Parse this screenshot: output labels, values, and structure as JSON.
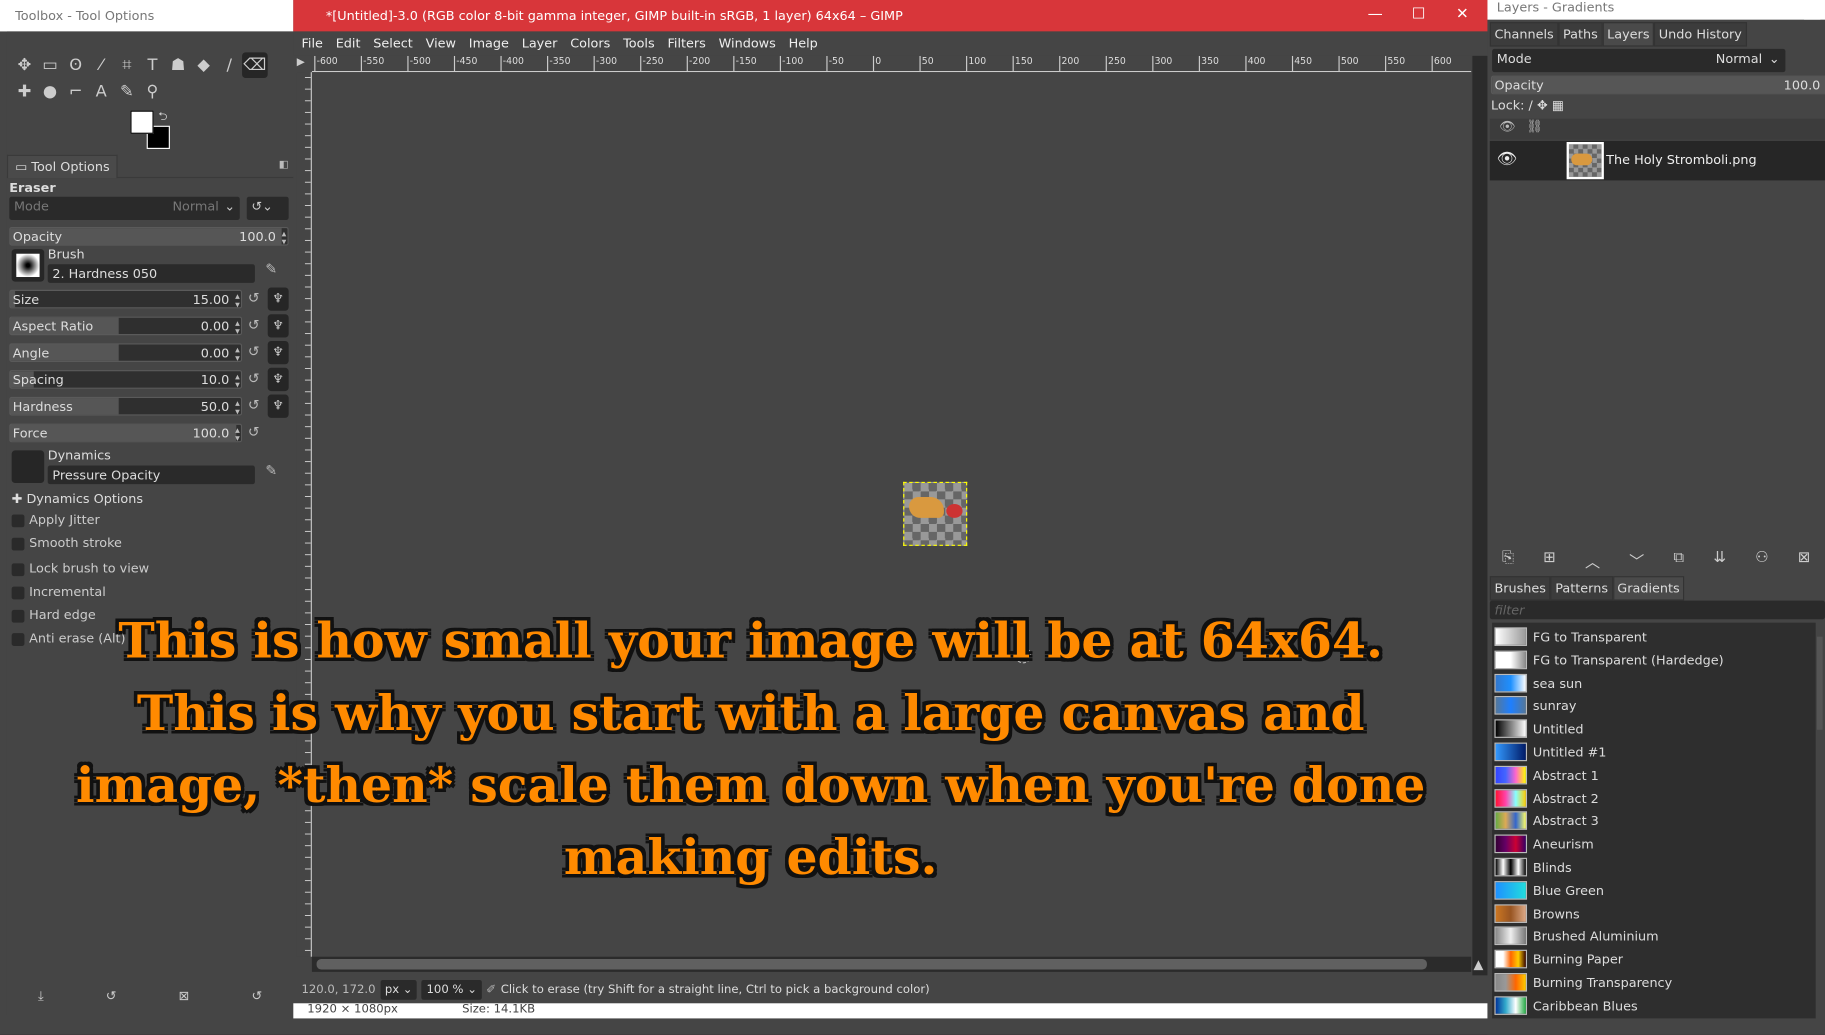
{
  "toolbox": {
    "title": "Toolbox - Tool Options",
    "tab": "Tool Options",
    "tool_name": "Eraser",
    "mode_label": "Mode",
    "mode_value": "Normal",
    "opacity": {
      "label": "Opacity",
      "value": "100.0"
    },
    "brush": {
      "label": "Brush",
      "value": "2. Hardness 050"
    },
    "sliders": [
      {
        "label": "Size",
        "value": "15.00",
        "fill": 0.02
      },
      {
        "label": "Aspect Ratio",
        "value": "0.00",
        "fill": 0.47
      },
      {
        "label": "Angle",
        "value": "0.00",
        "fill": 0.47
      },
      {
        "label": "Spacing",
        "value": "10.0",
        "fill": 0.1
      },
      {
        "label": "Hardness",
        "value": "50.0",
        "fill": 0.47
      },
      {
        "label": "Force",
        "value": "100.0",
        "fill": 0.98
      }
    ],
    "dynamics": {
      "label": "Dynamics",
      "value": "Pressure Opacity"
    },
    "dynamics_options": "Dynamics Options",
    "checkboxes": [
      "Apply Jitter",
      "Smooth stroke",
      "Lock brush to view",
      "Incremental",
      "Hard edge",
      "Anti erase  (Alt)"
    ]
  },
  "window": {
    "title": "*[Untitled]-3.0 (RGB color 8-bit gamma integer, GIMP built-in sRGB, 1 layer) 64x64 – GIMP",
    "menu": [
      "File",
      "Edit",
      "Select",
      "View",
      "Image",
      "Layer",
      "Colors",
      "Tools",
      "Filters",
      "Windows",
      "Help"
    ],
    "ruler_labels": [
      "-600",
      "-550",
      "-500",
      "-450",
      "-400",
      "-350",
      "-300",
      "-250",
      "-200",
      "-150",
      "-100",
      "-50",
      "0",
      "50",
      "100",
      "150",
      "200",
      "250",
      "300",
      "350",
      "400",
      "450",
      "500",
      "550",
      "600"
    ],
    "caption": "This is how small your image will be at 64x64. This is why you start with a large canvas and image, *then* scale them down when you're done making edits.",
    "status": {
      "coords": "120.0, 172.0",
      "unit": "px",
      "zoom": "100 %",
      "message": "Click to erase (try Shift for a straight line, Ctrl to pick a background color)"
    },
    "below": {
      "dimensions": "1920 × 1080px",
      "size": "Size: 14.1KB"
    }
  },
  "right": {
    "title": "Layers - Gradients",
    "tabs": [
      "Channels",
      "Paths",
      "Layers",
      "Undo History"
    ],
    "mode_label": "Mode",
    "mode_value": "Normal",
    "opacity_label": "Opacity",
    "opacity_value": "100.0",
    "lock_label": "Lock:",
    "layer_name": "The Holy Stromboli.png",
    "res_tabs": [
      "Brushes",
      "Patterns",
      "Gradients"
    ],
    "filter_placeholder": "filter",
    "gradients": [
      {
        "name": "FG to Transparent",
        "swatch": [
          "#ffffff",
          "#999999"
        ]
      },
      {
        "name": "FG to Transparent (Hardedge)",
        "swatch": [
          "#ffffff",
          "#ffffff",
          "#888888"
        ]
      },
      {
        "name": "sea sun",
        "swatch": [
          "#3377cc",
          "#1e90ff",
          "#ffffff"
        ]
      },
      {
        "name": "sunray",
        "swatch": [
          "#557799",
          "#1e7fff",
          "#557799"
        ]
      },
      {
        "name": "Untitled",
        "swatch": [
          "#000000",
          "#ffffff"
        ]
      },
      {
        "name": "Untitled #1",
        "swatch": [
          "#3399ff",
          "#001a66"
        ]
      },
      {
        "name": "Abstract 1",
        "swatch": [
          "#3344ff",
          "#4466ff",
          "#ff66cc",
          "#ffff00"
        ]
      },
      {
        "name": "Abstract 2",
        "swatch": [
          "#ff1133",
          "#ff44aa",
          "#88ffff",
          "#ffcc00"
        ]
      },
      {
        "name": "Abstract 3",
        "swatch": [
          "#66aa44",
          "#ddaa55",
          "#3366cc",
          "#ffff66"
        ]
      },
      {
        "name": "Aneurism",
        "swatch": [
          "#330033",
          "#660066",
          "#cc0033",
          "#330066"
        ]
      },
      {
        "name": "Blinds",
        "swatch": [
          "#000000",
          "#ffffff",
          "#000000",
          "#ffffff",
          "#000000"
        ]
      },
      {
        "name": "Blue Green",
        "swatch": [
          "#1e90ff",
          "#22dddd"
        ]
      },
      {
        "name": "Browns",
        "swatch": [
          "#cc7722",
          "#995522",
          "#ddaa88"
        ]
      },
      {
        "name": "Brushed Aluminium",
        "swatch": [
          "#888888",
          "#eeeeee",
          "#777777"
        ]
      },
      {
        "name": "Burning Paper",
        "swatch": [
          "#ffffff",
          "#ffffff",
          "#ff6600",
          "#ffcc00",
          "#330000"
        ]
      },
      {
        "name": "Burning Transparency",
        "swatch": [
          "#888888",
          "#999999",
          "#ff6600",
          "#ffcc00"
        ]
      },
      {
        "name": "Caribbean Blues",
        "swatch": [
          "#003399",
          "#33aacc",
          "#ffffff",
          "#22aa44"
        ]
      }
    ]
  }
}
